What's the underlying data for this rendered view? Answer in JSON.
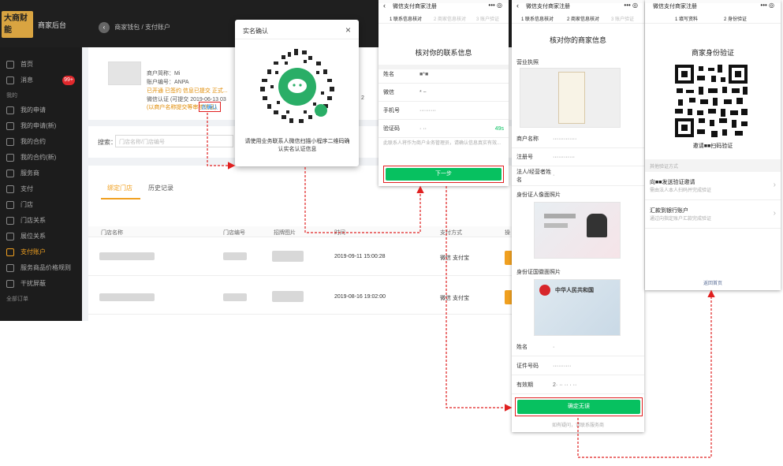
{
  "admin": {
    "brand_logo": "大商财能",
    "brand": "商家后台",
    "breadcrumb": {
      "parent": "商家钱包",
      "sep": "/",
      "current": "支付账户"
    },
    "nav": [
      {
        "label": "首页",
        "icon": "home-icon"
      },
      {
        "label": "消息",
        "icon": "message-icon",
        "badge": "99+"
      },
      {
        "group": "我的"
      },
      {
        "label": "我的申请",
        "icon": "apply-icon"
      },
      {
        "label": "我的申请(新)",
        "icon": "apply-new-icon"
      },
      {
        "label": "我的合约",
        "icon": "contract-icon"
      },
      {
        "label": "我的合约(新)",
        "icon": "contract-new-icon"
      },
      {
        "label": "服务商",
        "icon": "provider-icon"
      },
      {
        "label": "支付",
        "icon": "pay-icon"
      },
      {
        "label": "门店",
        "icon": "store-icon"
      },
      {
        "label": "门店关系",
        "icon": "store-relation-icon"
      },
      {
        "label": "展位关系",
        "icon": "booth-relation-icon"
      },
      {
        "label": "支付账户",
        "icon": "pay-account-icon",
        "active": true
      },
      {
        "label": "服务商品价格规则",
        "icon": "price-rule-icon"
      },
      {
        "label": "干扰屏蔽",
        "icon": "shield-icon"
      },
      {
        "group": "全部订单"
      }
    ],
    "account": {
      "lines": [
        "商户简称：Mi",
        "账户编号：ANPA",
        "已开通 已签约 信息已提交 正式...",
        "微信认证 (可提交 2019-06-13 03"
      ],
      "warn": "(以商户名称提交等审核信息)",
      "confirm_link": "去确认",
      "suffix": "2"
    },
    "search": {
      "label": "搜索：",
      "placeholder": "门店名称/门店编号"
    },
    "tabs": [
      "绑定门店",
      "历史记录"
    ],
    "table": {
      "headers": [
        "门店名称",
        "门店编号",
        "招牌图片",
        "时间",
        "支付方式",
        "操"
      ],
      "rows": [
        {
          "time": "2019-09-11 15:00:28",
          "pay": "微信 支付宝"
        },
        {
          "time": "2019-08-16 19:02:00",
          "pay": "微信 支付宝"
        }
      ]
    }
  },
  "modal": {
    "title": "实名确认",
    "close": "×",
    "text": "请使用业务联系人微信扫描小程序二维码确认实名认证信息"
  },
  "phone1": {
    "title": "微信支付商家注册",
    "menu": "••• ◎",
    "steps": [
      "1 联系信息核对",
      "2 商家信息核对",
      "3 账户验证"
    ],
    "heading": "核对你的联系信息",
    "fields": [
      {
        "label": "姓名",
        "value": "■*■"
      },
      {
        "label": "微信",
        "value": "*  ~"
      },
      {
        "label": "手机号",
        "value": "·········"
      },
      {
        "label": "验证码",
        "value": "·  ··",
        "extra": "49s"
      }
    ],
    "note": "此联系人将作为商户业务管理员，请确认信息真实有效...",
    "button": "下一步"
  },
  "phone2": {
    "title": "微信支付商家注册",
    "menu": "••• ◎",
    "steps": [
      "1 联系信息核对",
      "2 商家信息核对",
      "3 账户验证"
    ],
    "heading": "核对你的商家信息",
    "license_label": "营业执照",
    "fields": [
      {
        "label": "商户名称",
        "value": "·············"
      },
      {
        "label": "注册号",
        "value": "············"
      },
      {
        "label": "法人/经营者姓名",
        "value": "·"
      }
    ],
    "id_front_label": "身份证人像面照片",
    "id_back_label": "身份证国徽面照片",
    "id_back_title": "中华人民共和国",
    "fields2": [
      {
        "label": "姓名",
        "value": "·"
      },
      {
        "label": "证件号码",
        "value": "··········"
      },
      {
        "label": "有效期",
        "value": "2· ·· ·· · ··"
      }
    ],
    "button": "确定无误",
    "foot": "如有疑问，请联系服务商"
  },
  "phone3": {
    "title": "微信支付商家注册",
    "menu": "••• ◎",
    "steps": [
      "1 填写资料",
      "2 身份验证"
    ],
    "heading": "商家身份验证",
    "qr_caption": "邀请■■扫码验证",
    "other_label": "其他验证方式",
    "options": [
      {
        "title": "向■■发送验证邀请",
        "desc": "需由法人本人扫码并完成验证"
      },
      {
        "title": "汇款到银行账户",
        "desc": "通过向指定账户汇款完成验证"
      }
    ],
    "foot": "返回首页"
  },
  "colors": {
    "accent": "#f0a020",
    "wechat_green": "#07c160",
    "arrow": "#e02020",
    "sidebar": "#1c1c1c"
  }
}
